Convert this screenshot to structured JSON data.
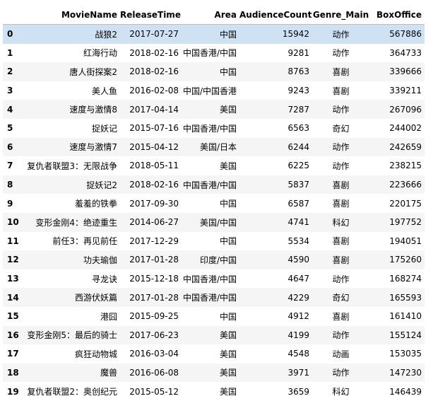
{
  "table": {
    "columns": {
      "index": "",
      "movie_name": "MovieName",
      "release_time": "ReleaseTime",
      "area": "Area",
      "audience_count": "AudienceCount",
      "genre_main": "Genre_Main",
      "box_office": "BoxOffice"
    },
    "highlight_color": "#cfe2f3",
    "rows": [
      {
        "index": "0",
        "movie_name": "战狼2",
        "release_time": "2017-07-27",
        "area": "中国",
        "audience_count": "15942",
        "genre_main": "动作",
        "box_office": "567886"
      },
      {
        "index": "1",
        "movie_name": "红海行动",
        "release_time": "2018-02-16",
        "area": "中国香港/中国",
        "audience_count": "9281",
        "genre_main": "动作",
        "box_office": "364733"
      },
      {
        "index": "2",
        "movie_name": "唐人街探案2",
        "release_time": "2018-02-16",
        "area": "中国",
        "audience_count": "8763",
        "genre_main": "喜剧",
        "box_office": "339666"
      },
      {
        "index": "3",
        "movie_name": "美人鱼",
        "release_time": "2016-02-08",
        "area": "中国/中国香港",
        "audience_count": "9243",
        "genre_main": "喜剧",
        "box_office": "339211"
      },
      {
        "index": "4",
        "movie_name": "速度与激情8",
        "release_time": "2017-04-14",
        "area": "美国",
        "audience_count": "7287",
        "genre_main": "动作",
        "box_office": "267096"
      },
      {
        "index": "5",
        "movie_name": "捉妖记",
        "release_time": "2015-07-16",
        "area": "中国香港/中国",
        "audience_count": "6563",
        "genre_main": "奇幻",
        "box_office": "244002"
      },
      {
        "index": "6",
        "movie_name": "速度与激情7",
        "release_time": "2015-04-12",
        "area": "美国/日本",
        "audience_count": "6244",
        "genre_main": "动作",
        "box_office": "242659"
      },
      {
        "index": "7",
        "movie_name": "复仇者联盟3：无限战争",
        "release_time": "2018-05-11",
        "area": "美国",
        "audience_count": "6225",
        "genre_main": "动作",
        "box_office": "238215"
      },
      {
        "index": "8",
        "movie_name": "捉妖记2",
        "release_time": "2018-02-16",
        "area": "中国香港/中国",
        "audience_count": "5837",
        "genre_main": "喜剧",
        "box_office": "223666"
      },
      {
        "index": "9",
        "movie_name": "羞羞的铁拳",
        "release_time": "2017-09-30",
        "area": "中国",
        "audience_count": "6587",
        "genre_main": "喜剧",
        "box_office": "220175"
      },
      {
        "index": "10",
        "movie_name": "变形金刚4：绝迹重生",
        "release_time": "2014-06-27",
        "area": "美国/中国",
        "audience_count": "4741",
        "genre_main": "科幻",
        "box_office": "197752"
      },
      {
        "index": "11",
        "movie_name": "前任3：再见前任",
        "release_time": "2017-12-29",
        "area": "中国",
        "audience_count": "5534",
        "genre_main": "喜剧",
        "box_office": "194051"
      },
      {
        "index": "12",
        "movie_name": "功夫瑜伽",
        "release_time": "2017-01-28",
        "area": "印度/中国",
        "audience_count": "4590",
        "genre_main": "喜剧",
        "box_office": "175260"
      },
      {
        "index": "13",
        "movie_name": "寻龙诀",
        "release_time": "2015-12-18",
        "area": "中国香港/中国",
        "audience_count": "4647",
        "genre_main": "动作",
        "box_office": "168274"
      },
      {
        "index": "14",
        "movie_name": "西游伏妖篇",
        "release_time": "2017-01-28",
        "area": "中国香港/中国",
        "audience_count": "4229",
        "genre_main": "奇幻",
        "box_office": "165593"
      },
      {
        "index": "15",
        "movie_name": "港囧",
        "release_time": "2015-09-25",
        "area": "中国",
        "audience_count": "4912",
        "genre_main": "喜剧",
        "box_office": "161410"
      },
      {
        "index": "16",
        "movie_name": "变形金刚5：最后的骑士",
        "release_time": "2017-06-23",
        "area": "美国",
        "audience_count": "4199",
        "genre_main": "动作",
        "box_office": "155124"
      },
      {
        "index": "17",
        "movie_name": "疯狂动物城",
        "release_time": "2016-03-04",
        "area": "美国",
        "audience_count": "4548",
        "genre_main": "动画",
        "box_office": "153035"
      },
      {
        "index": "18",
        "movie_name": "魔兽",
        "release_time": "2016-06-08",
        "area": "美国",
        "audience_count": "3971",
        "genre_main": "动作",
        "box_office": "147230"
      },
      {
        "index": "19",
        "movie_name": "复仇者联盟2：奥创纪元",
        "release_time": "2015-05-12",
        "area": "美国",
        "audience_count": "3659",
        "genre_main": "科幻",
        "box_office": "146439"
      }
    ]
  }
}
